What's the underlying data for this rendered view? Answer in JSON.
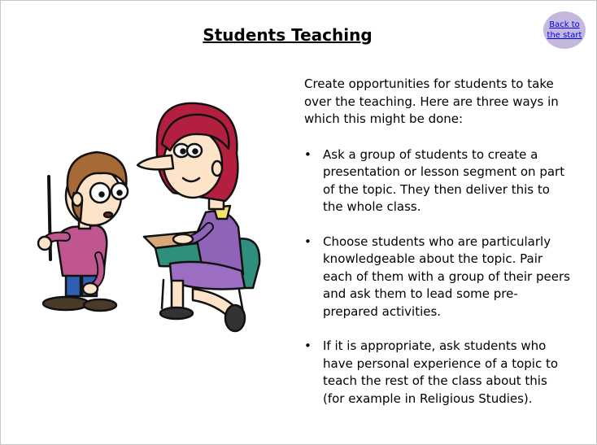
{
  "header": {
    "title": "Students Teaching",
    "back_link": {
      "line1": "Back to",
      "line2": "the start"
    }
  },
  "content": {
    "intro": "Create opportunities for students to take over the teaching. Here are three ways in which this might be done:",
    "points": [
      "Ask a group of students to create a presentation or lesson segment on part of the topic. They then deliver this to the whole class.",
      "Choose students who are particularly knowledgeable about the topic. Pair each of them with a group of their peers and ask them to lead some pre-prepared activities.",
      "If it is appropriate, ask students who have personal experience of a topic to teach the rest of the class about this (for example in Religious Studies)."
    ]
  },
  "colors": {
    "back_button_fill": "#c5b8dd",
    "link": "#0000ee",
    "teacher_hair": "#b51f3f",
    "teacher_sweater": "#8e63b8",
    "student_sweater": "#c0568f",
    "desk": "#2f8f7c"
  },
  "illustration": {
    "icon": "cartoon-student-teaching-teacher"
  }
}
